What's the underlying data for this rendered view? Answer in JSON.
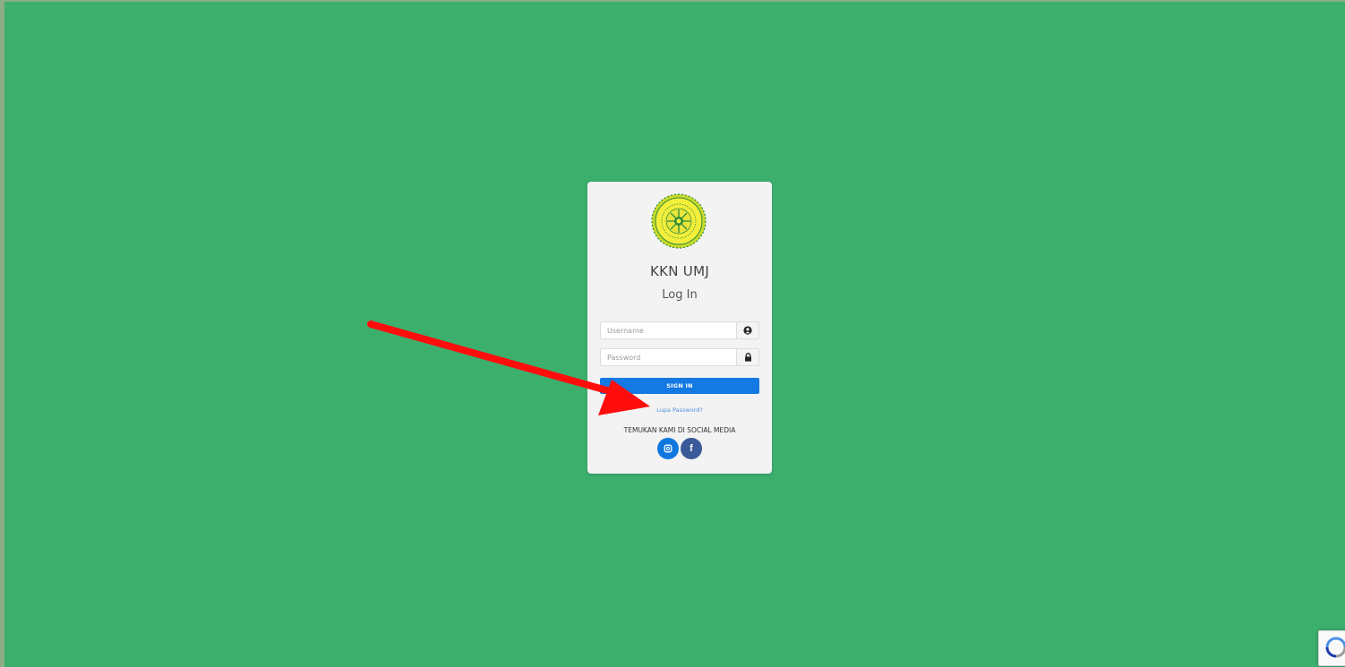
{
  "login": {
    "app_title": "KKN UMJ",
    "heading": "Log In",
    "username": {
      "placeholder": "Username",
      "value": ""
    },
    "password": {
      "placeholder": "Password",
      "value": ""
    },
    "sign_in_label": "SIGN IN",
    "forgot_password_label": "Lupa Password?",
    "social_label": "TEMUKAN KAMI DI SOCIAL MEDIA",
    "social_icons": [
      "instagram-icon",
      "facebook-icon"
    ],
    "logo_icon": "university-seal-logo"
  },
  "overlay": {
    "annotation_icon": "red-arrow-pointing-to-forgot-password"
  },
  "widgets": {
    "recaptcha_icon": "recaptcha-badge"
  },
  "colors": {
    "background": "#3daf6d",
    "card": "#f3f3f3",
    "primary_button": "#1479e3",
    "link": "#4f8fdc",
    "instagram": "#1177e0",
    "facebook": "#3b5a9a",
    "annotation_arrow": "#ff0d0d"
  }
}
